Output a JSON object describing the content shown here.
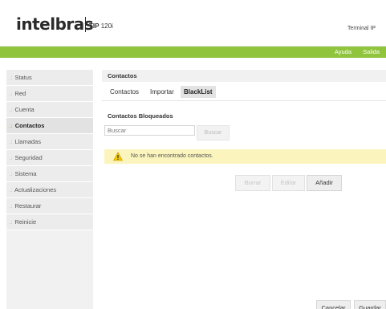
{
  "header": {
    "brand": "intelbras",
    "model_prefix": "TIP",
    "model_number": "120i",
    "device_label": "Terminal IP"
  },
  "topbar": {
    "help": "Ayuda",
    "logout": "Salida",
    "bar_color": "#8fc43c"
  },
  "sidebar": {
    "bullet": ".:",
    "items": [
      {
        "label": "Status"
      },
      {
        "label": "Red"
      },
      {
        "label": "Cuenta"
      },
      {
        "label": "Contactos"
      },
      {
        "label": "Llamadas"
      },
      {
        "label": "Seguridad"
      },
      {
        "label": "Sistema"
      },
      {
        "label": "Actualizaciones"
      },
      {
        "label": "Restaurar"
      },
      {
        "label": "Reinicie"
      }
    ],
    "active": "Contactos"
  },
  "main": {
    "title": "Contactos",
    "tabs": [
      {
        "label": "Contactos"
      },
      {
        "label": "Importar"
      },
      {
        "label": "BlackList"
      }
    ],
    "active_tab": "BlackList",
    "blocked_title": "Contactos Bloqueados",
    "search_placeholder": "Buscar",
    "search_button": "Buscar",
    "notice": "No se han encontrado contactos.",
    "actions": {
      "delete": "Borrar",
      "edit": "Editar",
      "add": "Añadir"
    },
    "footer": {
      "cancel": "Cancelar",
      "save": "Guardar"
    }
  }
}
